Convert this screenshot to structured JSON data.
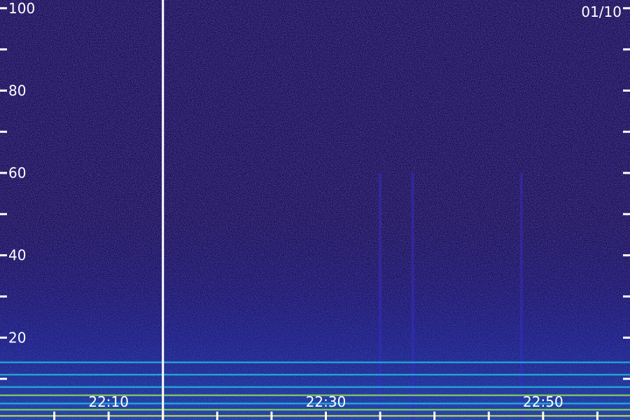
{
  "chart_data": {
    "type": "heatmap",
    "title": "",
    "xlabel": "",
    "ylabel": "",
    "date_label": "01/10",
    "y_axis": {
      "range": [
        0,
        102
      ],
      "tick_labels": [
        {
          "value": 20,
          "label": "20"
        },
        {
          "value": 40,
          "label": "40"
        },
        {
          "value": 60,
          "label": "60"
        },
        {
          "value": 80,
          "label": "80"
        },
        {
          "value": 100,
          "label": "100"
        }
      ],
      "minor_ticks": [
        10,
        30,
        50,
        70,
        90
      ]
    },
    "x_axis": {
      "range": [
        "22:00",
        "22:58"
      ],
      "tick_labels": [
        {
          "time": "22:10",
          "label": "22:10"
        },
        {
          "time": "22:30",
          "label": "22:30"
        },
        {
          "time": "22:50",
          "label": "22:50"
        }
      ],
      "minor_ticks": [
        "22:05",
        "22:15",
        "22:20",
        "22:25",
        "22:35",
        "22:40",
        "22:45",
        "22:55"
      ],
      "gap_marker_time": "22:15"
    },
    "colors": {
      "background": "#10083a",
      "noise_low": "#1a0f6e",
      "noise_high": "#3a2dcc",
      "band_cyan": "#22c8e8",
      "band_green": "#9cf04a",
      "band_yellow": "#f0f040",
      "axis": "#ffffff"
    },
    "bands": [
      {
        "value": 1,
        "color": "#f0f040"
      },
      {
        "value": 2.5,
        "color": "#9cf04a"
      },
      {
        "value": 4,
        "color": "#22c8e8"
      },
      {
        "value": 6,
        "color": "#9cf04a"
      },
      {
        "value": 8,
        "color": "#22c8e8"
      },
      {
        "value": 11,
        "color": "#22c8e8"
      },
      {
        "value": 14,
        "color": "#22c8e8"
      }
    ],
    "vertical_streaks": [
      "22:35",
      "22:38",
      "22:48"
    ]
  }
}
